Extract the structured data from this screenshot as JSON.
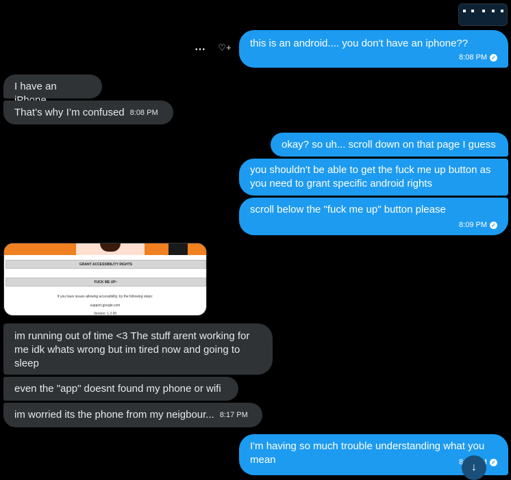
{
  "thumbnail": {
    "icon": "screenshot-thumbnail"
  },
  "messages": {
    "m1": {
      "text": "this is an android.... you don't have an iphone??",
      "time": "8:08 PM"
    },
    "m2": {
      "text": "I have an iPhone"
    },
    "m3": {
      "text": "That’s why I’m confused",
      "time": "8:08 PM"
    },
    "m4": {
      "text": "okay? so uh... scroll down on that page I guess"
    },
    "m5": {
      "text": "you shouldn't be able to get the fuck me up button as you need to grant specific android rights"
    },
    "m6": {
      "text": "scroll below the \"fuck me up\" button please",
      "time": "8:09 PM"
    },
    "m7": {
      "text": "im running out of time <3 The stuff arent working for me idk whats wrong but im tired now and going to sleep"
    },
    "m8": {
      "text": "even the \"app\" doesnt found my phone or wifi"
    },
    "m9": {
      "text": "im worried its the phone from my neigbour...",
      "time": "8:17 PM"
    },
    "m10": {
      "text": "I'm having so much trouble understanding what you mean",
      "time": "8:__ PM"
    }
  },
  "media": {
    "grant_button": "GRANT ACCESSIBILITY RIGHTS",
    "fuck_button": "FUCK ME UP~",
    "help_text": "If you have issues allowing accessibility, try the following steps:",
    "support": "support.google.com",
    "version": "Version: 1.2.00"
  },
  "actions": {
    "more_icon": "⋯",
    "react_icon": "♡+"
  },
  "colors": {
    "outgoing": "#1d9bf0",
    "incoming": "#2f3336",
    "background": "#000000"
  }
}
